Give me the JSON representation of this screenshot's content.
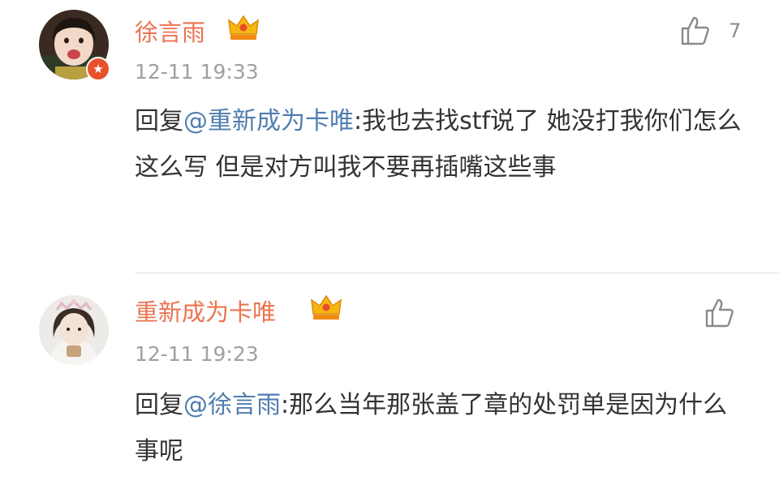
{
  "comments": [
    {
      "username": "徐言雨",
      "timestamp": "12-11 19:33",
      "like_count": "7",
      "reply_prefix": "回复",
      "mention": "@重新成为卡唯",
      "text": ":我也去找stf说了 她没打我你们怎么这么写 但是对方叫我不要再插嘴这些事",
      "verified_badge": "verified-badge-icon",
      "crown": "crown-icon"
    },
    {
      "username": "重新成为卡唯",
      "timestamp": "12-11 19:23",
      "reply_prefix": "回复",
      "mention": "@徐言雨",
      "text": ":那么当年那张盖了章的处罚单是因为什么事呢",
      "crown": "crown-icon"
    }
  ],
  "colors": {
    "username": "#eb7350",
    "mention": "#507daf",
    "text": "#333333",
    "timestamp": "#a0a0a0"
  }
}
